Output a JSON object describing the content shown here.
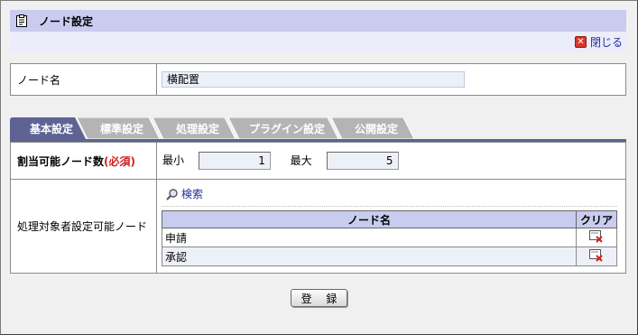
{
  "header": {
    "title": "ノード設定",
    "close_label": "閉じる"
  },
  "node": {
    "label": "ノード名",
    "value": "横配置"
  },
  "tabs": [
    {
      "label": "基本設定",
      "active": true
    },
    {
      "label": "標準設定",
      "active": false
    },
    {
      "label": "処理設定",
      "active": false
    },
    {
      "label": "プラグイン設定",
      "active": false
    },
    {
      "label": "公開設定",
      "active": false
    }
  ],
  "assign": {
    "label": "割当可能ノード数",
    "required": "(必須)",
    "min_label": "最小",
    "min_value": "1",
    "max_label": "最大",
    "max_value": "5"
  },
  "targets": {
    "label": "処理対象者設定可能ノード",
    "search_label": "検索",
    "columns": {
      "name": "ノード名",
      "clear": "クリア"
    },
    "rows": [
      {
        "name": "申請"
      },
      {
        "name": "承認"
      }
    ]
  },
  "footer": {
    "register_label": "登 録"
  },
  "colors": {
    "header_bg": "#c9ccee",
    "active_tab": "#5e6394",
    "inactive_tab": "#b4b4b4",
    "required": "#d12020",
    "link": "#1f2e9c"
  }
}
